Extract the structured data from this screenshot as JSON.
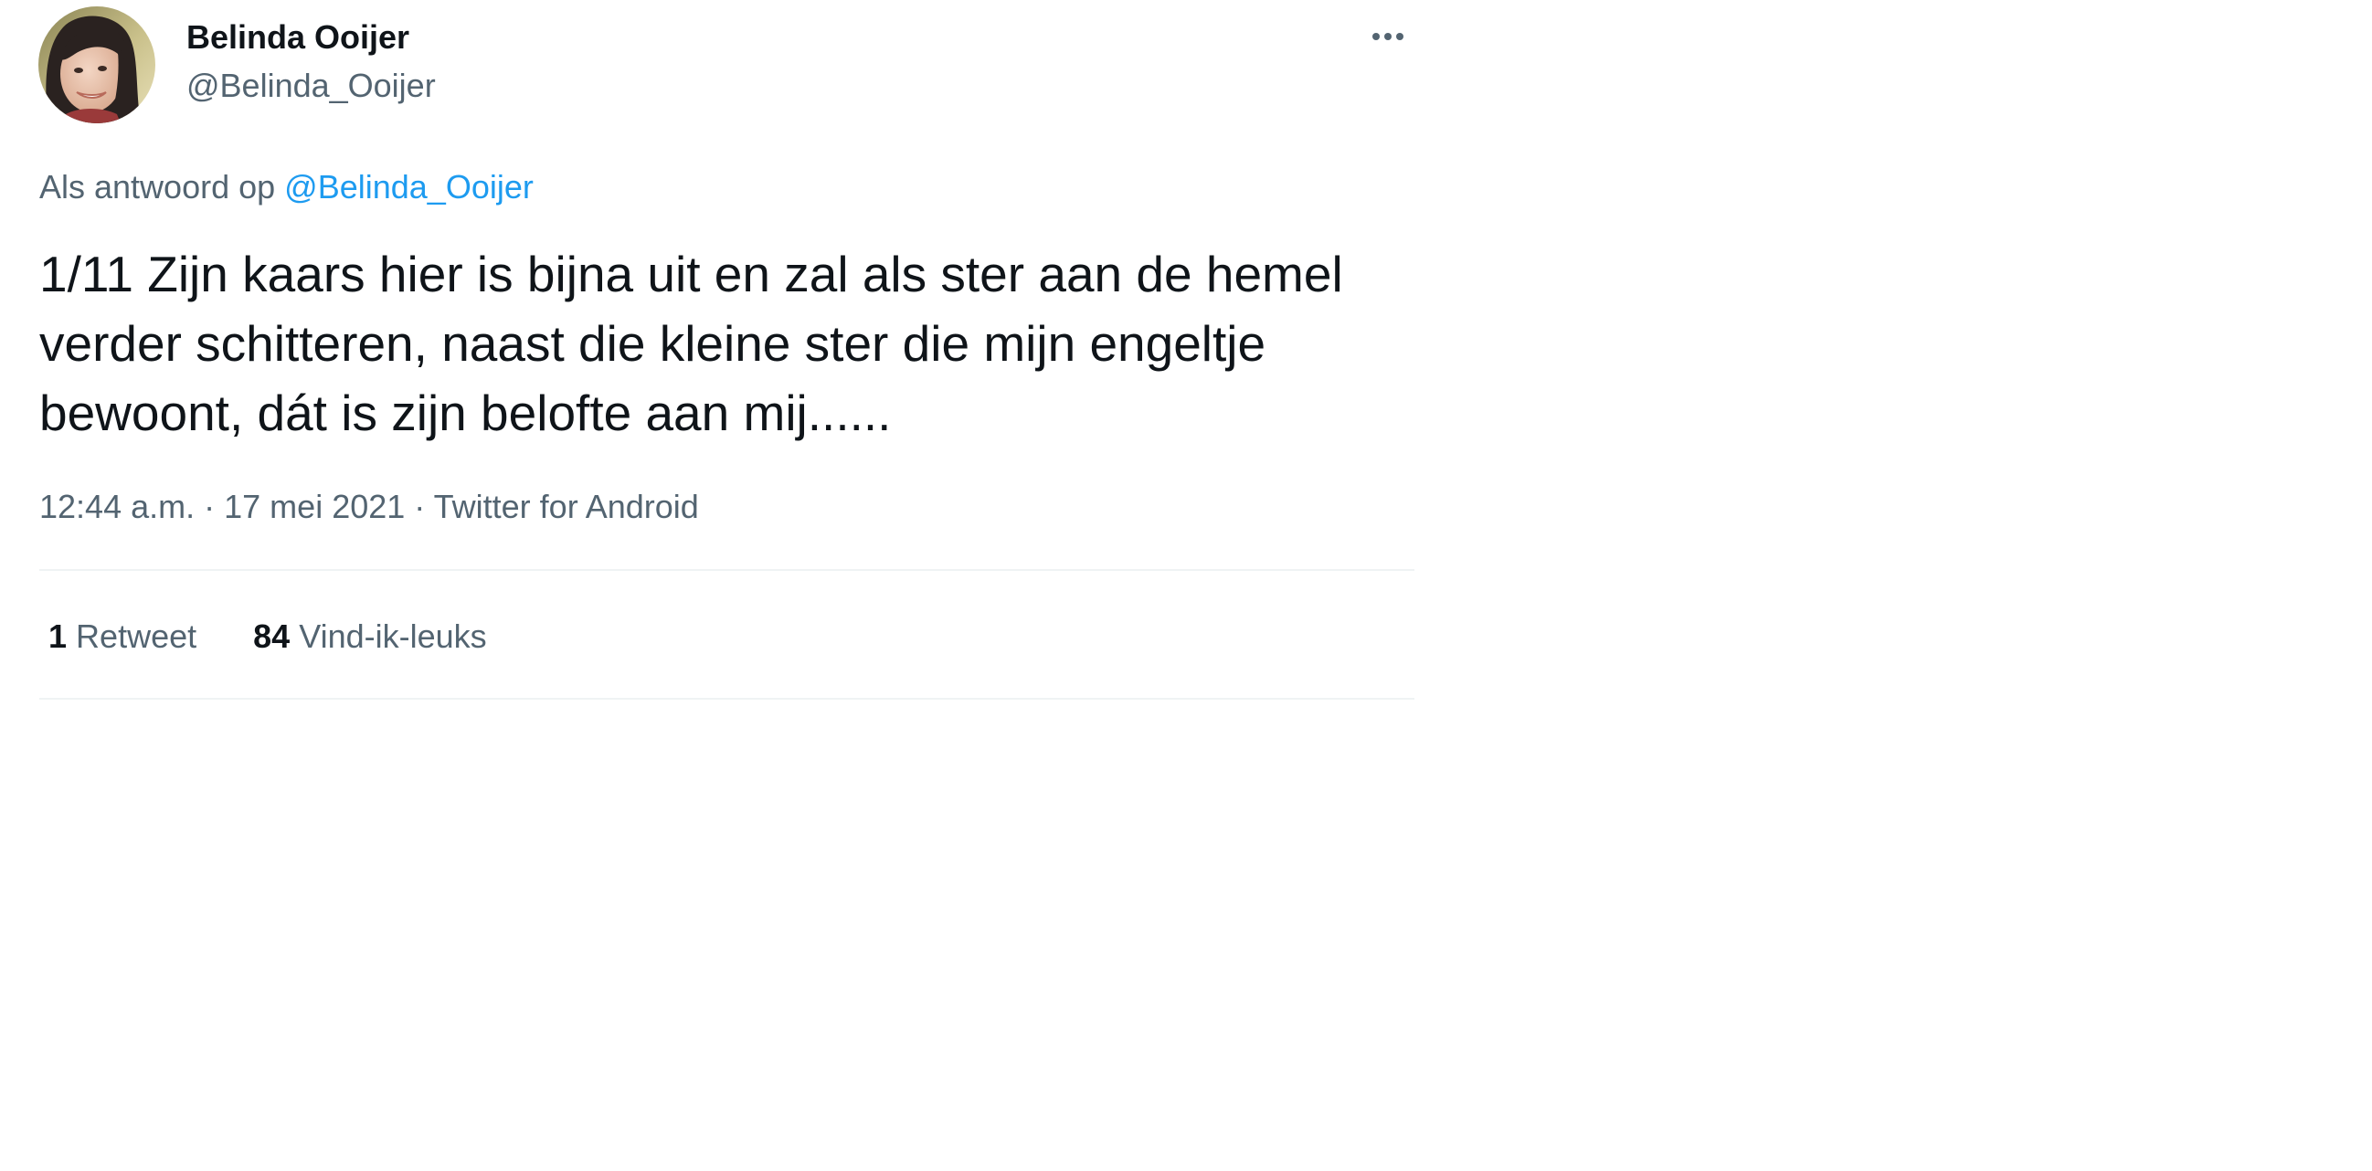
{
  "colors": {
    "text_primary": "#0f1419",
    "text_secondary": "#536471",
    "link": "#1d9bf0",
    "divider": "#eff3f4"
  },
  "author": {
    "display_name": "Belinda Ooijer",
    "handle": "@Belinda_Ooijer",
    "avatar_icon": "profile-photo"
  },
  "menu": {
    "more_icon": "more-horizontal-icon"
  },
  "reply_context": {
    "prefix": "Als antwoord op",
    "mention": "@Belinda_Ooijer"
  },
  "tweet": {
    "text": "1/11 Zijn kaars hier is bijna uit en zal als ster aan de hemel verder schitteren, naast die kleine ster die mijn engeltje bewoont, dát is zijn belofte aan mij......"
  },
  "meta": {
    "time": "12:44 a.m.",
    "date": "17 mei 2021",
    "source": "Twitter for Android",
    "separator": "·"
  },
  "stats": {
    "retweets": {
      "count": "1",
      "label": "Retweet"
    },
    "likes": {
      "count": "84",
      "label": "Vind-ik-leuks"
    }
  }
}
